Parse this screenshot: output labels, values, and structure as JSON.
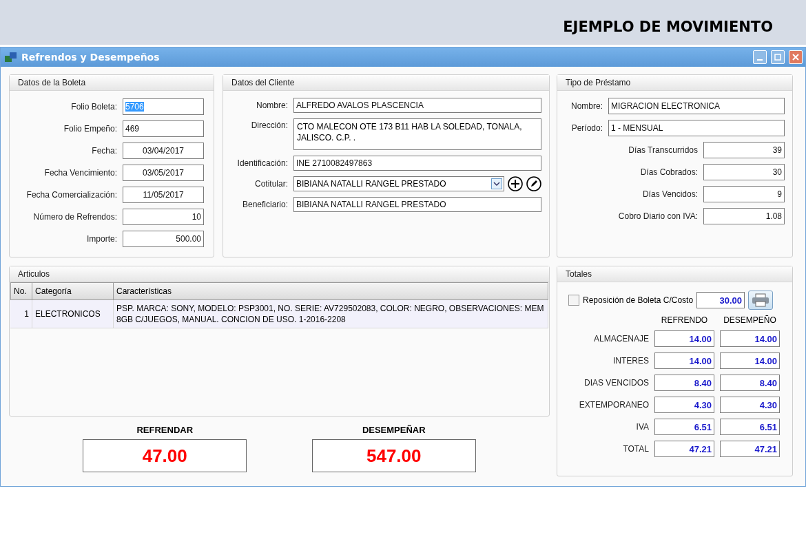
{
  "banner": {
    "title": "EJEMPLO DE MOVIMIENTO"
  },
  "window": {
    "title": "Refrendos y Desempeños"
  },
  "boleta": {
    "title": "Datos de la Boleta",
    "fields": [
      {
        "kind": "text",
        "label": "Folio Boleta:",
        "value": "5706",
        "selected": true
      },
      {
        "kind": "text",
        "label": "Folio Empeño:",
        "value": "469",
        "selected": false
      },
      {
        "kind": "date",
        "label": "Fecha:",
        "value": "03/04/2017",
        "selected": false
      },
      {
        "kind": "date",
        "label": "Fecha Vencimiento:",
        "value": "03/05/2017",
        "selected": false
      },
      {
        "kind": "date",
        "label": "Fecha Comercialización:",
        "value": "11/05/2017",
        "selected": false
      },
      {
        "kind": "number",
        "label": "Número de Refrendos:",
        "value": "10",
        "selected": false
      },
      {
        "kind": "number",
        "label": "Importe:",
        "value": "500.00",
        "selected": false
      }
    ]
  },
  "cliente": {
    "title": "Datos del Cliente",
    "fields": [
      {
        "kind": "text",
        "label": "Nombre:",
        "value": "ALFREDO AVALOS PLASCENCIA"
      },
      {
        "kind": "multiline",
        "label": "Dirección:",
        "value": "CTO MALECON OTE 173 B11 HAB LA SOLEDAD, TONALA, JALISCO. C.P. ."
      },
      {
        "kind": "text",
        "label": "Identificación:",
        "value": "INE 2710082497863"
      },
      {
        "kind": "combo",
        "label": "Cotitular:",
        "value": "BIBIANA NATALLI RANGEL PRESTADO"
      },
      {
        "kind": "text",
        "label": "Beneficiario:",
        "value": "BIBIANA NATALLI RANGEL PRESTADO"
      }
    ]
  },
  "prestamo": {
    "title": "Tipo de Préstamo",
    "fields": [
      {
        "kind": "wide",
        "label": "Nombre:",
        "value": "MIGRACION ELECTRONICA"
      },
      {
        "kind": "wide",
        "label": "Período:",
        "value": "1 - MENSUAL"
      },
      {
        "kind": "number",
        "label": "Días Transcurridos",
        "value": "39"
      },
      {
        "kind": "number",
        "label": "Días Cobrados:",
        "value": "30"
      },
      {
        "kind": "number",
        "label": "Días Vencidos:",
        "value": "9"
      },
      {
        "kind": "number",
        "label": "Cobro Diario con IVA:",
        "value": "1.08"
      }
    ]
  },
  "articulos": {
    "title": "Articulos",
    "columns": [
      "No.",
      "Categoría",
      "Características"
    ],
    "rows": [
      [
        "1",
        "ELECTRONICOS",
        "PSP. MARCA: SONY, MODELO: PSP3001, NO. SERIE: AV729502083, COLOR: NEGRO, OBSERVACIONES: MEM 8GB C/JUEGOS, MANUAL. CONCION DE USO. 1-2016-2208"
      ]
    ]
  },
  "summary": [
    {
      "label": "REFRENDAR",
      "value": "47.00"
    },
    {
      "label": "DESEMPEÑAR",
      "value": "547.00"
    }
  ],
  "totales": {
    "title": "Totales",
    "reposicion": {
      "label": "Reposición de Boleta C/Costo",
      "checked": false,
      "value": "30.00"
    },
    "columns": [
      "REFRENDO",
      "DESEMPEÑO"
    ],
    "rows": [
      {
        "label": "ALMACENAJE",
        "values": [
          "14.00",
          "14.00"
        ]
      },
      {
        "label": "INTERES",
        "values": [
          "14.00",
          "14.00"
        ]
      },
      {
        "label": "DIAS VENCIDOS",
        "values": [
          "8.40",
          "8.40"
        ]
      },
      {
        "label": "EXTEMPORANEO",
        "values": [
          "4.30",
          "4.30"
        ]
      },
      {
        "label": "IVA",
        "values": [
          "6.51",
          "6.51"
        ]
      },
      {
        "label": "TOTAL",
        "values": [
          "47.21",
          "47.21"
        ]
      }
    ]
  }
}
